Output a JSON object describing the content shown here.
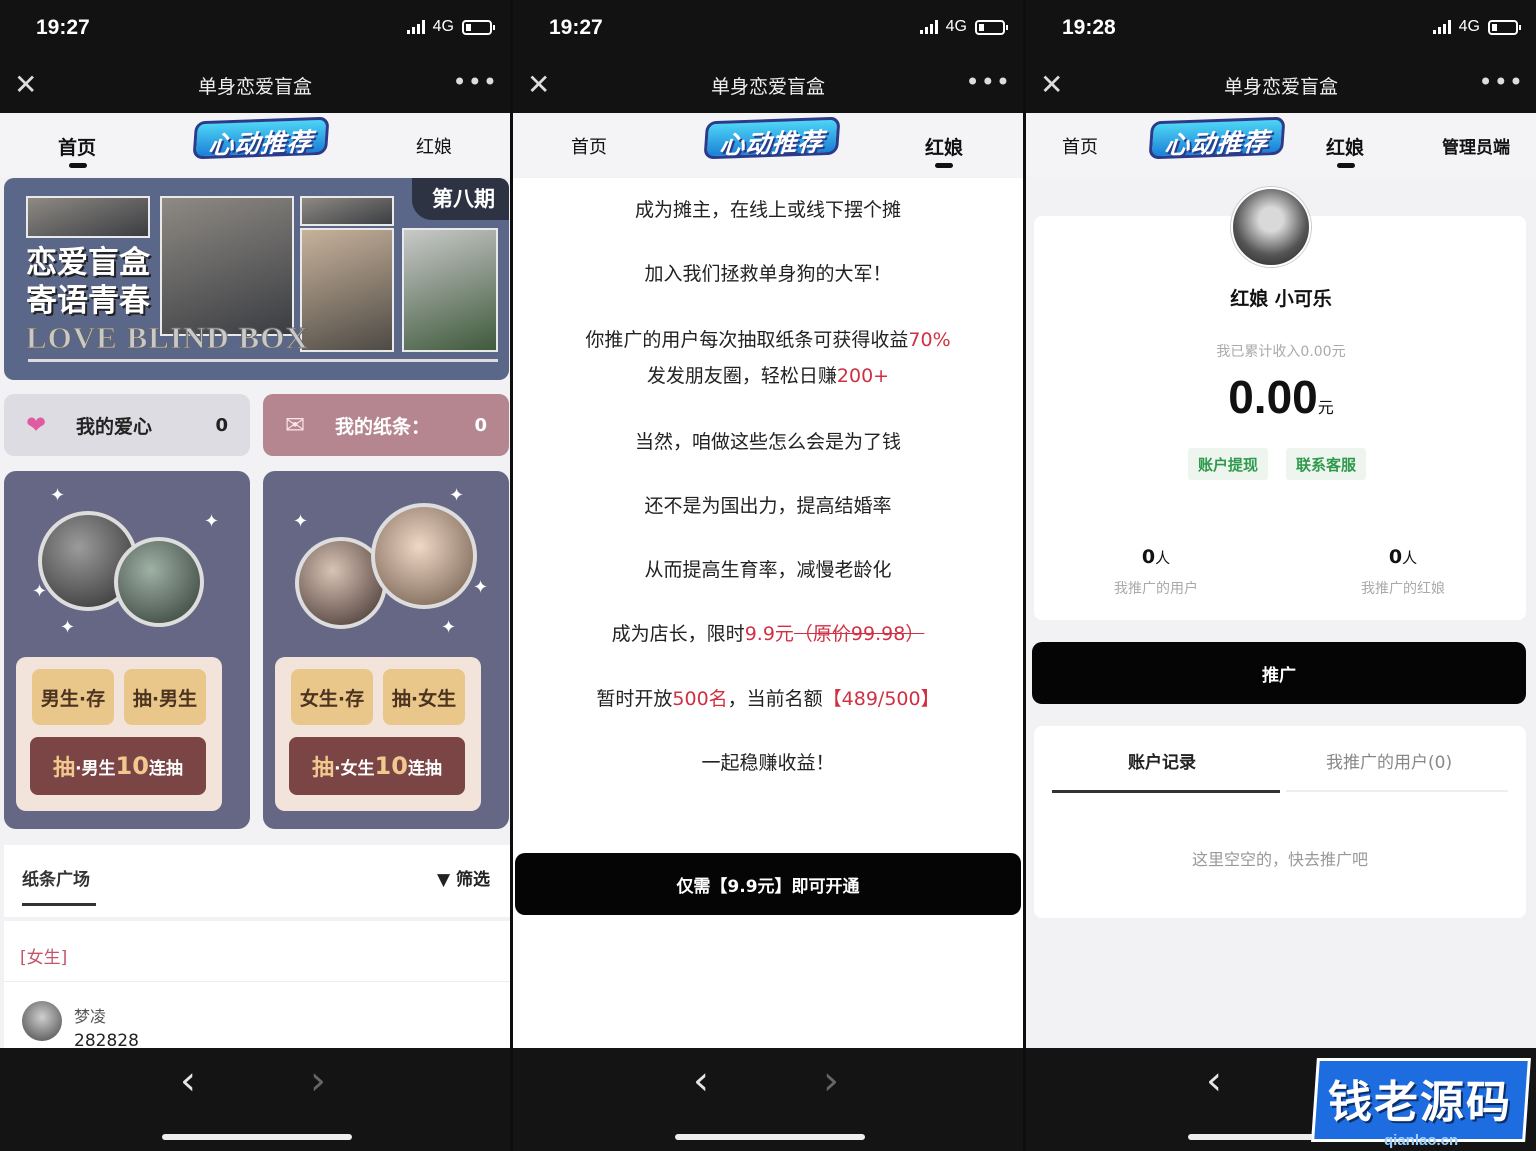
{
  "screens": [
    {
      "status_time": "19:27",
      "network": "4G",
      "title": "单身恋爱盲盒",
      "tabs": {
        "home": "首页",
        "logo": "心动推荐",
        "matchmaker": "红娘"
      },
      "banner": {
        "title_line1": "恋爱盲盒",
        "title_line2": "寄语青春",
        "english": "LOVE BLIND BOX",
        "issue": "第八期"
      },
      "my_hearts": {
        "label": "我的爱心",
        "count": "0"
      },
      "my_notes": {
        "label": "我的纸条：",
        "count": "0"
      },
      "male_box": {
        "store": "男生·存",
        "draw": "抽·男生",
        "draw10_prefix": "抽",
        "draw10_mid": "·男生",
        "draw10_num": "10",
        "draw10_suffix": "连抽"
      },
      "female_box": {
        "store": "女生·存",
        "draw": "抽·女生",
        "draw10_prefix": "抽",
        "draw10_mid": "·女生",
        "draw10_num": "10",
        "draw10_suffix": "连抽"
      },
      "note_square": {
        "title": "纸条广场",
        "filter": "筛选"
      },
      "post": {
        "tag": "[女生]",
        "name": "梦凌",
        "id": "282828"
      }
    },
    {
      "status_time": "19:27",
      "network": "4G",
      "title": "单身恋爱盲盒",
      "tabs": {
        "home": "首页",
        "logo": "心动推荐",
        "matchmaker": "红娘"
      },
      "promo": {
        "line1": "成为摊主，在线上或线下摆个摊",
        "line2": "加入我们拯救单身狗的大军！",
        "line3_text": "你推广的用户每次抽取纸条可获得收益",
        "line3_red": "70%",
        "line4_text": "发发朋友圈，轻松日赚",
        "line4_red": "200+",
        "line5": "当然，咱做这些怎么会是为了钱",
        "line6": "还不是为国出力，提高结婚率",
        "line7": "从而提高生育率，减慢老龄化",
        "line8_text": "成为店长，限时",
        "line8_red": "9.9元",
        "line8_strike": "（原价99.98）",
        "line9_text1": "暂时开放",
        "line9_red1": "500名",
        "line9_text2": "，当前名额",
        "line9_red2": "【489/500】",
        "line10": "一起稳赚收益！"
      },
      "open_button": "仅需【9.9元】即可开通"
    },
    {
      "status_time": "19:28",
      "network": "4G",
      "title": "单身恋爱盲盒",
      "tabs": {
        "home": "首页",
        "logo": "心动推荐",
        "matchmaker": "红娘",
        "admin": "管理员端"
      },
      "profile": {
        "name": "红娘 小可乐",
        "income_label": "我已累计收入0.00元",
        "amount": "0.00",
        "unit": "元",
        "withdraw": "账户提现",
        "support": "联系客服",
        "users_count": "0",
        "users_unit": "人",
        "users_label": "我推广的用户",
        "mm_count": "0",
        "mm_unit": "人",
        "mm_label": "我推广的红娘"
      },
      "promote_button": "推广",
      "records": {
        "tab1": "账户记录",
        "tab2": "我推广的用户(0)",
        "empty": "这里空空的，快去推广吧"
      }
    }
  ],
  "watermark": {
    "text": "钱老源码",
    "url": "qianlao.cn"
  },
  "colors": {
    "accent_red": "#d03043",
    "success_green": "#2f9a4d",
    "black_button": "#050505"
  }
}
